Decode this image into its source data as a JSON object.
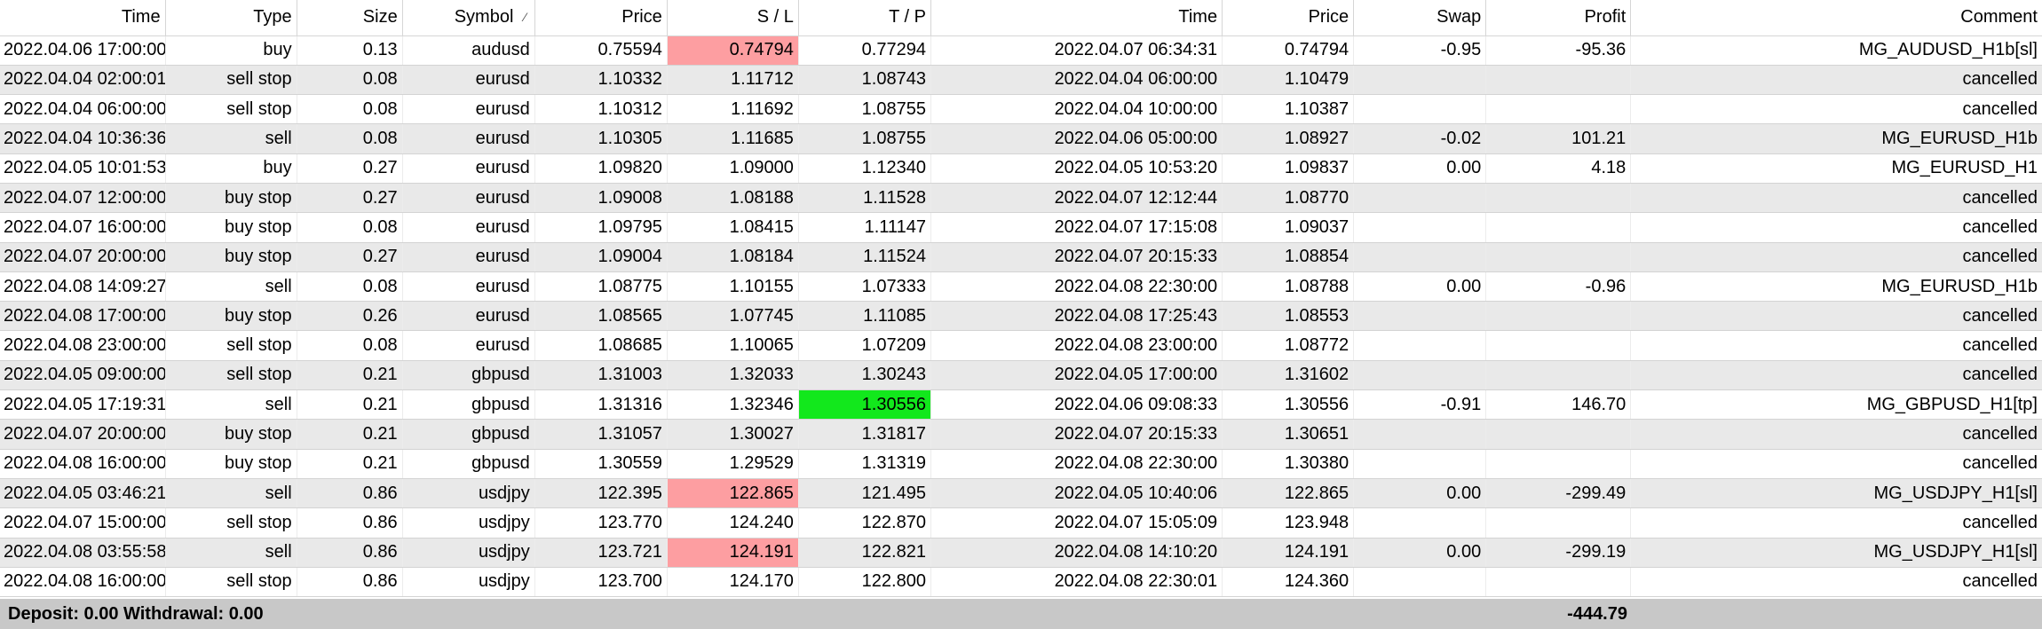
{
  "headers": [
    "Time",
    "Type",
    "Size",
    "Symbol",
    "Price",
    "S / L",
    "T / P",
    "Time",
    "Price",
    "Swap",
    "Profit",
    "Comment"
  ],
  "sort_indicator": "⁄",
  "highlight_colors": {
    "red": "#fd9ea1",
    "green": "#12e81c"
  },
  "rows": [
    {
      "cells": [
        "2022.04.06 17:00:00",
        "buy",
        "0.13",
        "audusd",
        "0.75594",
        "0.74794",
        "0.77294",
        "2022.04.07 06:34:31",
        "0.74794",
        "-0.95",
        "-95.36",
        "MG_AUDUSD_H1b[sl]"
      ],
      "highlight": {
        "col": 5,
        "color": "red"
      }
    },
    {
      "cells": [
        "2022.04.04 02:00:01",
        "sell stop",
        "0.08",
        "eurusd",
        "1.10332",
        "1.11712",
        "1.08743",
        "2022.04.04 06:00:00",
        "1.10479",
        "",
        "",
        "cancelled"
      ]
    },
    {
      "cells": [
        "2022.04.04 06:00:00",
        "sell stop",
        "0.08",
        "eurusd",
        "1.10312",
        "1.11692",
        "1.08755",
        "2022.04.04 10:00:00",
        "1.10387",
        "",
        "",
        "cancelled"
      ]
    },
    {
      "cells": [
        "2022.04.04 10:36:36",
        "sell",
        "0.08",
        "eurusd",
        "1.10305",
        "1.11685",
        "1.08755",
        "2022.04.06 05:00:00",
        "1.08927",
        "-0.02",
        "101.21",
        "MG_EURUSD_H1b"
      ]
    },
    {
      "cells": [
        "2022.04.05 10:01:53",
        "buy",
        "0.27",
        "eurusd",
        "1.09820",
        "1.09000",
        "1.12340",
        "2022.04.05 10:53:20",
        "1.09837",
        "0.00",
        "4.18",
        "MG_EURUSD_H1"
      ]
    },
    {
      "cells": [
        "2022.04.07 12:00:00",
        "buy stop",
        "0.27",
        "eurusd",
        "1.09008",
        "1.08188",
        "1.11528",
        "2022.04.07 12:12:44",
        "1.08770",
        "",
        "",
        "cancelled"
      ]
    },
    {
      "cells": [
        "2022.04.07 16:00:00",
        "buy stop",
        "0.08",
        "eurusd",
        "1.09795",
        "1.08415",
        "1.11147",
        "2022.04.07 17:15:08",
        "1.09037",
        "",
        "",
        "cancelled"
      ]
    },
    {
      "cells": [
        "2022.04.07 20:00:00",
        "buy stop",
        "0.27",
        "eurusd",
        "1.09004",
        "1.08184",
        "1.11524",
        "2022.04.07 20:15:33",
        "1.08854",
        "",
        "",
        "cancelled"
      ]
    },
    {
      "cells": [
        "2022.04.08 14:09:27",
        "sell",
        "0.08",
        "eurusd",
        "1.08775",
        "1.10155",
        "1.07333",
        "2022.04.08 22:30:00",
        "1.08788",
        "0.00",
        "-0.96",
        "MG_EURUSD_H1b"
      ]
    },
    {
      "cells": [
        "2022.04.08 17:00:00",
        "buy stop",
        "0.26",
        "eurusd",
        "1.08565",
        "1.07745",
        "1.11085",
        "2022.04.08 17:25:43",
        "1.08553",
        "",
        "",
        "cancelled"
      ]
    },
    {
      "cells": [
        "2022.04.08 23:00:00",
        "sell stop",
        "0.08",
        "eurusd",
        "1.08685",
        "1.10065",
        "1.07209",
        "2022.04.08 23:00:00",
        "1.08772",
        "",
        "",
        "cancelled"
      ]
    },
    {
      "cells": [
        "2022.04.05 09:00:00",
        "sell stop",
        "0.21",
        "gbpusd",
        "1.31003",
        "1.32033",
        "1.30243",
        "2022.04.05 17:00:00",
        "1.31602",
        "",
        "",
        "cancelled"
      ]
    },
    {
      "cells": [
        "2022.04.05 17:19:31",
        "sell",
        "0.21",
        "gbpusd",
        "1.31316",
        "1.32346",
        "1.30556",
        "2022.04.06 09:08:33",
        "1.30556",
        "-0.91",
        "146.70",
        "MG_GBPUSD_H1[tp]"
      ],
      "highlight": {
        "col": 6,
        "color": "green"
      }
    },
    {
      "cells": [
        "2022.04.07 20:00:00",
        "buy stop",
        "0.21",
        "gbpusd",
        "1.31057",
        "1.30027",
        "1.31817",
        "2022.04.07 20:15:33",
        "1.30651",
        "",
        "",
        "cancelled"
      ]
    },
    {
      "cells": [
        "2022.04.08 16:00:00",
        "buy stop",
        "0.21",
        "gbpusd",
        "1.30559",
        "1.29529",
        "1.31319",
        "2022.04.08 22:30:00",
        "1.30380",
        "",
        "",
        "cancelled"
      ]
    },
    {
      "cells": [
        "2022.04.05 03:46:21",
        "sell",
        "0.86",
        "usdjpy",
        "122.395",
        "122.865",
        "121.495",
        "2022.04.05 10:40:06",
        "122.865",
        "0.00",
        "-299.49",
        "MG_USDJPY_H1[sl]"
      ],
      "highlight": {
        "col": 5,
        "color": "red"
      }
    },
    {
      "cells": [
        "2022.04.07 15:00:00",
        "sell stop",
        "0.86",
        "usdjpy",
        "123.770",
        "124.240",
        "122.870",
        "2022.04.07 15:05:09",
        "123.948",
        "",
        "",
        "cancelled"
      ]
    },
    {
      "cells": [
        "2022.04.08 03:55:58",
        "sell",
        "0.86",
        "usdjpy",
        "123.721",
        "124.191",
        "122.821",
        "2022.04.08 14:10:20",
        "124.191",
        "0.00",
        "-299.19",
        "MG_USDJPY_H1[sl]"
      ],
      "highlight": {
        "col": 5,
        "color": "red"
      }
    },
    {
      "cells": [
        "2022.04.08 16:00:00",
        "sell stop",
        "0.86",
        "usdjpy",
        "123.700",
        "124.170",
        "122.800",
        "2022.04.08 22:30:01",
        "124.360",
        "",
        "",
        "cancelled"
      ]
    }
  ],
  "footer": {
    "deposit_text": "Deposit: 0.00  Withdrawal: 0.00",
    "total_profit": "-444.79"
  }
}
